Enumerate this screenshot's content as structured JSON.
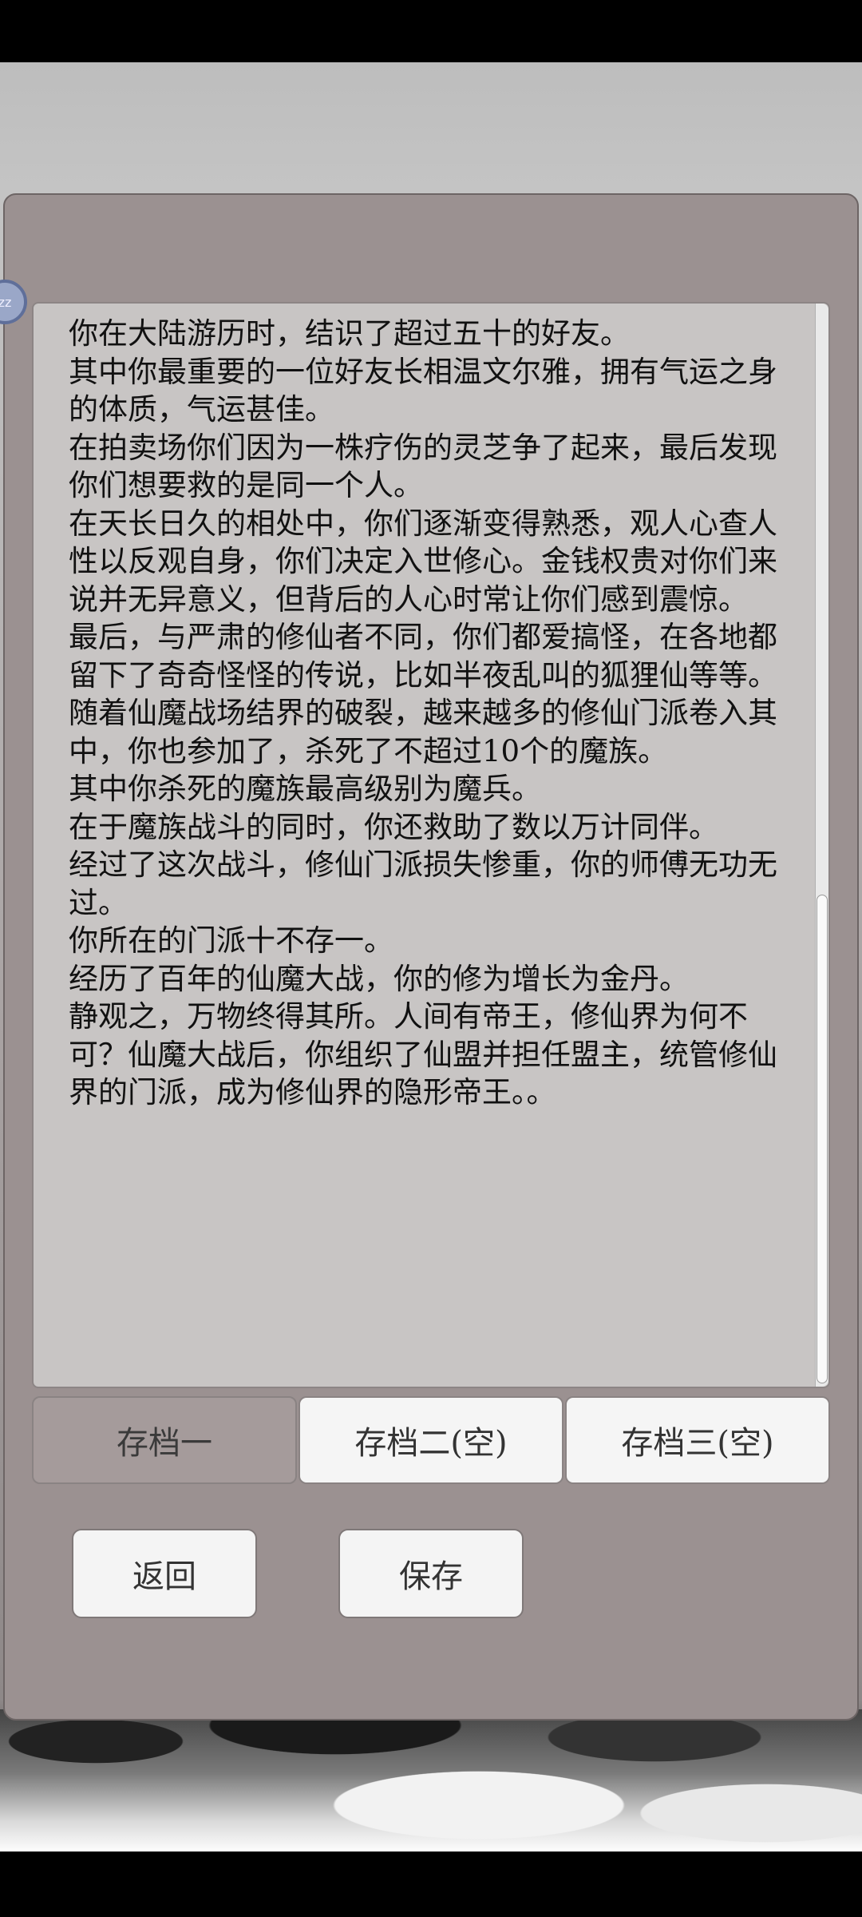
{
  "avatar": {
    "label": "zz"
  },
  "story": {
    "text": "你在大陆游历时，结识了超过五十的好友。\n其中你最重要的一位好友长相温文尔雅，拥有气运之身的体质，气运甚佳。\n在拍卖场你们因为一株疗伤的灵芝争了起来，最后发现你们想要救的是同一个人。\n在天长日久的相处中，你们逐渐变得熟悉，观人心查人性以反观自身，你们决定入世修心。金钱权贵对你们来说并无异意义，但背后的人心时常让你们感到震惊。\n最后，与严肃的修仙者不同，你们都爱搞怪，在各地都留下了奇奇怪怪的传说，比如半夜乱叫的狐狸仙等等。\n随着仙魔战场结界的破裂，越来越多的修仙门派卷入其中，你也参加了，杀死了不超过10个的魔族。\n其中你杀死的魔族最高级别为魔兵。\n在于魔族战斗的同时，你还救助了数以万计同伴。\n经过了这次战斗，修仙门派损失惨重，你的师傅无功无过。\n你所在的门派十不存一。\n经历了百年的仙魔大战，你的修为增长为金丹。\n静观之，万物终得其所。人间有帝王，修仙界为何不可？仙魔大战后，你组织了仙盟并担任盟主，统管修仙界的门派，成为修仙界的隐形帝王。。"
  },
  "slots": [
    {
      "label": "存档一"
    },
    {
      "label": "存档二(空)"
    },
    {
      "label": "存档三(空)"
    }
  ],
  "buttons": {
    "back": "返回",
    "save": "保存"
  }
}
